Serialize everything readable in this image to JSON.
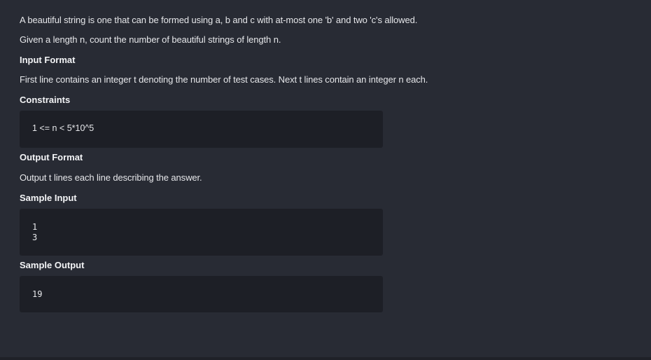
{
  "problem": {
    "statement_line1": "A beautiful string is one that can be formed using a, b and c with at-most one 'b' and two 'c's allowed.",
    "statement_line2": "Given a length n, count the number of beautiful strings of length n.",
    "input_format_heading": "Input Format",
    "input_format_text": "First line contains an integer t denoting the number of test cases. Next t lines contain an integer n each.",
    "constraints_heading": "Constraints",
    "constraints_text": "1 <= n < 5*10^5",
    "output_format_heading": "Output Format",
    "output_format_text": "Output t lines each line describing the answer.",
    "sample_input_heading": "Sample Input",
    "sample_input_lines": [
      "1",
      "3"
    ],
    "sample_output_heading": "Sample Output",
    "sample_output_lines": [
      "19"
    ]
  }
}
